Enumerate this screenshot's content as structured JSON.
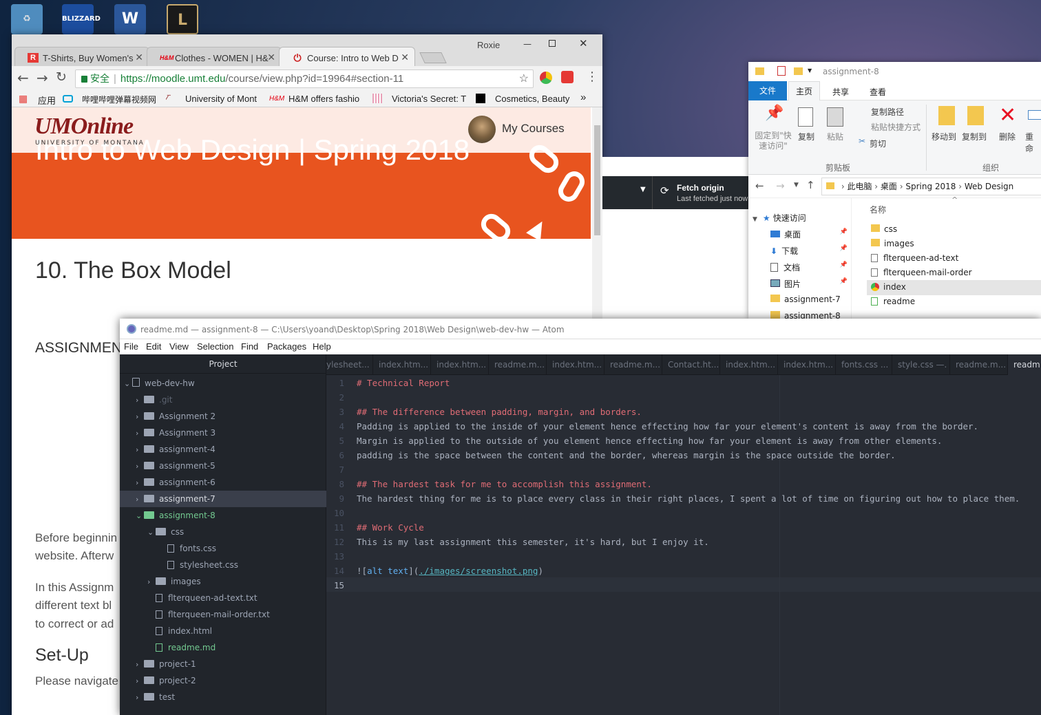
{
  "desktop": {
    "icons": [
      {
        "name": "recycle-bin-icon",
        "color": "#5a9fd4"
      },
      {
        "name": "blizzard-icon",
        "label": "BLIZZARD",
        "color": "#1c4d9e"
      },
      {
        "name": "word-icon",
        "label": "W",
        "color": "#2b579a"
      },
      {
        "name": "league-icon",
        "label": "L",
        "color": "#c8aa6e"
      }
    ]
  },
  "chrome": {
    "user": "Roxie",
    "tabs": [
      {
        "label": "T-Shirts, Buy Women's",
        "favicon": "R",
        "favcolor": "#e53935"
      },
      {
        "label": "Clothes - WOMEN | H&",
        "favicon": "H&M",
        "favcolor": "#e50010"
      },
      {
        "label": "Course: Intro to Web D",
        "favicon": "⏻",
        "favcolor": "#cc2222"
      }
    ],
    "secure": "安全",
    "url_host": "https://moodle.umt.edu",
    "url_path": "/course/view.php?id=19964#section-11",
    "bookmarks": [
      {
        "label": "应用"
      },
      {
        "label": "哔哩哔哩弹幕视频网"
      },
      {
        "label": "University of Mont"
      },
      {
        "label": "H&M offers fashio"
      },
      {
        "label": "Victoria's Secret: Th"
      },
      {
        "label": "Cosmetics, Beauty"
      }
    ],
    "more": "»"
  },
  "moodle": {
    "logo": "UMOnline",
    "logo_sub": "UNIVERSITY OF MONTANA",
    "mycourses": "My Courses",
    "banner_title": "Intro to Web Design | Spring 2018",
    "section_title": "10. The Box Model",
    "assignment_heading": "ASSIGNMEN",
    "para1": [
      "Before beginnin",
      "website. Afterw"
    ],
    "para2": [
      "In this Assignm",
      "different text bl",
      "to correct or ad"
    ],
    "setup": "Set-Up",
    "setup_text": "Please navigate"
  },
  "git": {
    "fetch_title": "Fetch origin",
    "fetch_sub": "Last fetched just now"
  },
  "explorer": {
    "title": "assignment-8",
    "ribbon_tabs": [
      "文件",
      "主页",
      "共享",
      "查看"
    ],
    "ribbon": {
      "pin": "固定到\"快\n速访问\"",
      "copy": "复制",
      "paste": "粘贴",
      "copy_path": "复制路径",
      "paste_shortcut": "粘贴快捷方式",
      "cut": "剪切",
      "clipboard": "剪贴板",
      "move_to": "移动到",
      "copy_to": "复制到",
      "delete": "删除",
      "rename": "重命",
      "organize": "组织"
    },
    "breadcrumb": [
      "此电脑",
      "桌面",
      "Spring 2018",
      "Web Design"
    ],
    "column_name": "名称",
    "nav": [
      {
        "label": "快速访问"
      },
      {
        "label": "桌面"
      },
      {
        "label": "下载"
      },
      {
        "label": "文档"
      },
      {
        "label": "图片"
      },
      {
        "label": "assignment-7"
      },
      {
        "label": "assignment-8"
      }
    ],
    "files": [
      {
        "label": "css",
        "kind": "folder"
      },
      {
        "label": "images",
        "kind": "folder"
      },
      {
        "label": "flterqueen-ad-text",
        "kind": "file"
      },
      {
        "label": "flterqueen-mail-order",
        "kind": "file"
      },
      {
        "label": "index",
        "kind": "chrome"
      },
      {
        "label": "readme",
        "kind": "md"
      }
    ]
  },
  "atom": {
    "title": "readme.md — assignment-8 — C:\\Users\\yoand\\Desktop\\Spring 2018\\Web Design\\web-dev-hw — Atom",
    "menu": [
      "File",
      "Edit",
      "View",
      "Selection",
      "Find",
      "Packages",
      "Help"
    ],
    "panel_title": "Project",
    "tree": [
      {
        "label": "web-dev-hw",
        "depth": 0,
        "type": "repo",
        "open": true
      },
      {
        "label": ".git",
        "depth": 1,
        "type": "folder",
        "dim": true
      },
      {
        "label": "Assignment 2",
        "depth": 1,
        "type": "folder"
      },
      {
        "label": "Assignment 3",
        "depth": 1,
        "type": "folder"
      },
      {
        "label": "assignment-4",
        "depth": 1,
        "type": "folder"
      },
      {
        "label": "assignment-5",
        "depth": 1,
        "type": "folder"
      },
      {
        "label": "assignment-6",
        "depth": 1,
        "type": "folder"
      },
      {
        "label": "assignment-7",
        "depth": 1,
        "type": "folder",
        "selected": true
      },
      {
        "label": "assignment-8",
        "depth": 1,
        "type": "folder",
        "open": true,
        "green": true
      },
      {
        "label": "css",
        "depth": 2,
        "type": "folder",
        "open": true
      },
      {
        "label": "fonts.css",
        "depth": 3,
        "type": "file"
      },
      {
        "label": "stylesheet.css",
        "depth": 3,
        "type": "file"
      },
      {
        "label": "images",
        "depth": 2,
        "type": "folder"
      },
      {
        "label": "flterqueen-ad-text.txt",
        "depth": 2,
        "type": "file"
      },
      {
        "label": "flterqueen-mail-order.txt",
        "depth": 2,
        "type": "file"
      },
      {
        "label": "index.html",
        "depth": 2,
        "type": "file"
      },
      {
        "label": "readme.md",
        "depth": 2,
        "type": "file",
        "green": true
      },
      {
        "label": "project-1",
        "depth": 1,
        "type": "folder"
      },
      {
        "label": "project-2",
        "depth": 1,
        "type": "folder"
      },
      {
        "label": "test",
        "depth": 1,
        "type": "folder"
      }
    ],
    "tabs": [
      "ylesheet...",
      "index.htm...",
      "index.htm...",
      "readme.m...",
      "index.htm...",
      "readme.m...",
      "Contact.ht...",
      "index.htm...",
      "index.htm...",
      "fonts.css ...",
      "style.css —.",
      "readme.m...",
      "readm"
    ],
    "lines": [
      [
        {
          "t": "# Technical Report",
          "c": "h"
        }
      ],
      [],
      [
        {
          "t": "## The difference between padding, margin, and borders.",
          "c": "h"
        }
      ],
      [
        {
          "t": "Padding is applied to the inside of your element hence effecting how far your element's content is away from the border."
        }
      ],
      [
        {
          "t": "Margin is applied to the outside of you element hence effecting how far your element is away from other elements."
        }
      ],
      [
        {
          "t": "padding is the space between the content and the border, whereas margin is the space outside the border."
        }
      ],
      [],
      [
        {
          "t": "## The hardest task for me to accomplish this assignment.",
          "c": "h"
        }
      ],
      [
        {
          "t": "The hardest thing for me is to place every class in their right places, I spent a lot of time on figuring out how to place them."
        }
      ],
      [],
      [
        {
          "t": "## Work Cycle",
          "c": "h"
        }
      ],
      [
        {
          "t": "This is my last assignment this semester, it's hard, but I enjoy it."
        }
      ],
      [],
      [
        {
          "t": "!["
        },
        {
          "t": "alt text",
          "c": "lk"
        },
        {
          "t": "]("
        },
        {
          "t": "./images/screenshot.png",
          "c": "ur"
        },
        {
          "t": ")"
        }
      ],
      []
    ]
  }
}
